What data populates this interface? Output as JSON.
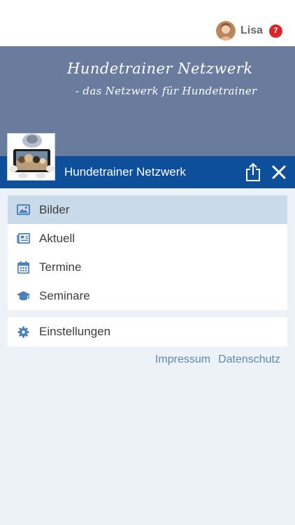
{
  "header": {
    "user_name": "Lisa",
    "notification_count": "7"
  },
  "banner": {
    "title": "Hundetrainer Netzwerk",
    "subtitle": "- das Netzwerk für Hundetrainer"
  },
  "titlebar": {
    "title": "Hundetrainer Netzwerk"
  },
  "menu": {
    "items": [
      {
        "label": "Bilder",
        "icon": "image-icon",
        "active": true
      },
      {
        "label": "Aktuell",
        "icon": "newspaper-icon",
        "active": false
      },
      {
        "label": "Termine",
        "icon": "calendar-icon",
        "active": false
      },
      {
        "label": "Seminare",
        "icon": "graduation-cap-icon",
        "active": false
      }
    ],
    "settings_label": "Einstellungen"
  },
  "footer": {
    "impressum": "Impressum",
    "datenschutz": "Datenschutz"
  },
  "colors": {
    "accent": "#0d4f9a",
    "banner": "#6a7c9e",
    "icon": "#4a80b8",
    "badge": "#d9262b",
    "active_item": "#c9daeb"
  }
}
